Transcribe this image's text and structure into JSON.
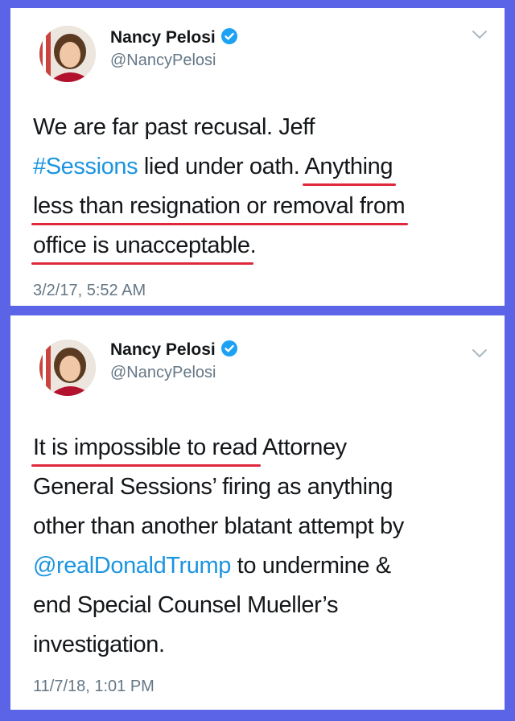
{
  "tweets": [
    {
      "name": "Nancy Pelosi",
      "handle": "@NancyPelosi",
      "verified": true,
      "lines": [
        {
          "text": "We are far past recusal. Jeff"
        },
        {
          "link": "#Sessions",
          "text": " lied under oath. ",
          "underlined": "Anything"
        },
        {
          "underlined": "less than resignation or removal from"
        },
        {
          "underlined": "office is unacceptable",
          "text": "."
        }
      ],
      "timestamp": "3/2/17, 5:52 AM"
    },
    {
      "name": "Nancy Pelosi",
      "handle": "@NancyPelosi",
      "verified": true,
      "lines": [
        {
          "underlined": "It is impossible to read",
          "text": " Attorney"
        },
        {
          "text": "General Sessions’ firing as anything"
        },
        {
          "text": "other than another blatant attempt by"
        },
        {
          "link": "@realDonaldTrump",
          "text": " to undermine &"
        },
        {
          "text": "end Special Counsel Mueller’s"
        },
        {
          "text": "investigation."
        }
      ],
      "timestamp": "11/7/18, 1:01 PM"
    }
  ],
  "colors": {
    "background": "#5b63e6",
    "link": "#1b95e0",
    "underline": "#e0283c",
    "verified": "#1da1f2"
  },
  "icons": {
    "verified": "verified-badge-icon",
    "chevron": "chevron-down-icon"
  }
}
